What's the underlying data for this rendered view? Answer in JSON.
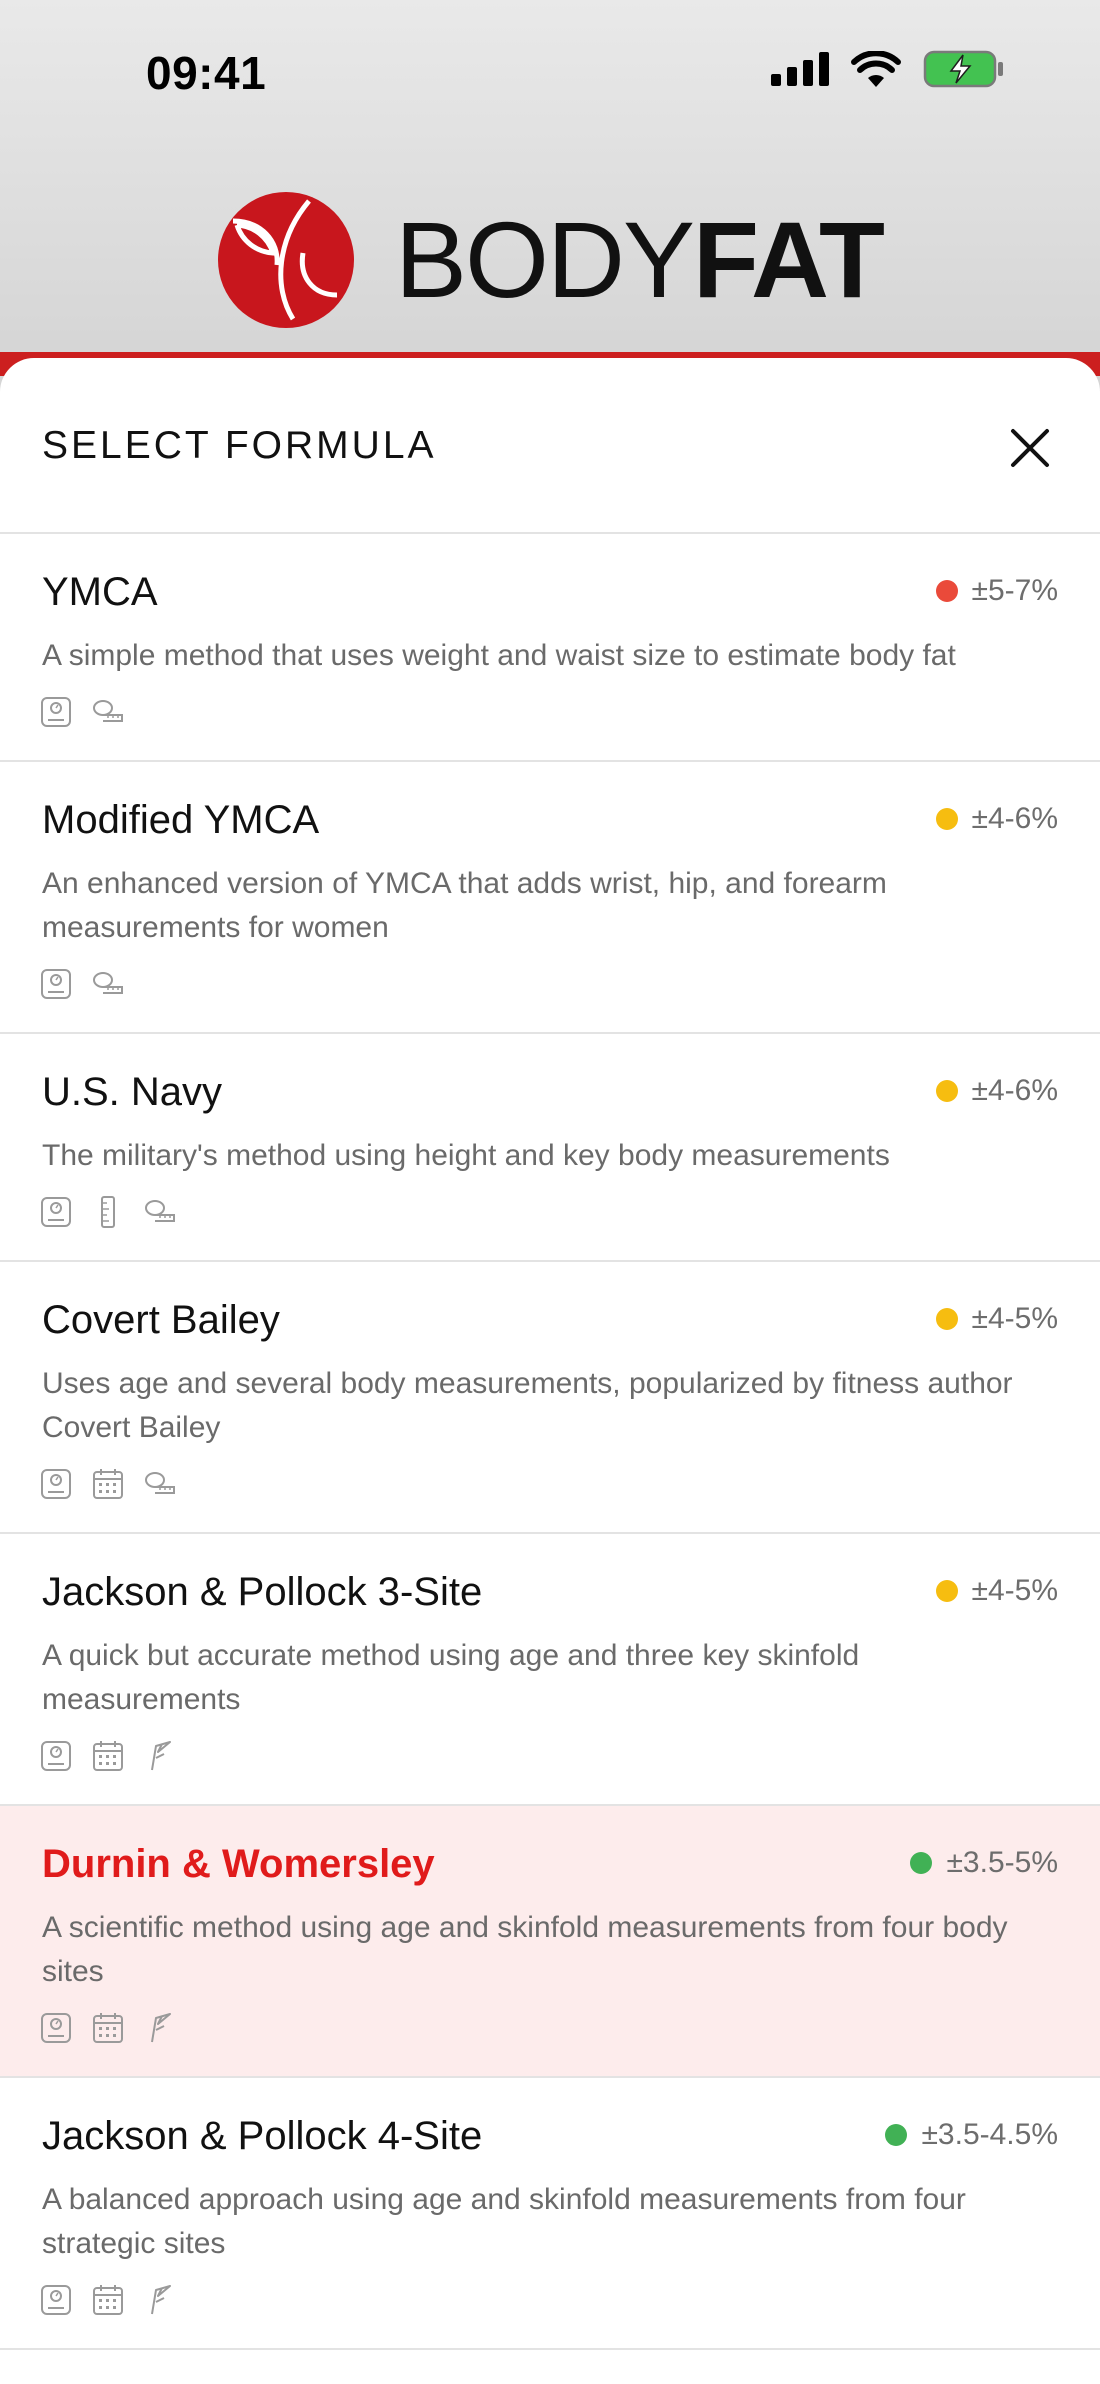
{
  "status": {
    "time": "09:41"
  },
  "logo": {
    "word_thin": "BODY",
    "word_bold": "FAT"
  },
  "sheet": {
    "title": "SELECT FORMULA"
  },
  "colors": {
    "red": "#e74c3c",
    "yellow": "#f5bd0c",
    "green": "#3fb14f",
    "brand_red": "#c8161d"
  },
  "formulas": [
    {
      "name": "YMCA",
      "accuracy": "±5-7%",
      "dot_color": "#ea4a3a",
      "description": "A simple method that uses weight and waist size to estimate body fat",
      "icons": [
        "scale-icon",
        "tape-measure-icon"
      ],
      "selected": false
    },
    {
      "name": "Modified YMCA",
      "accuracy": "±4-6%",
      "dot_color": "#f6bd10",
      "description": "An enhanced version of YMCA that adds wrist, hip, and forearm measurements for women",
      "icons": [
        "scale-icon",
        "tape-measure-icon"
      ],
      "selected": false
    },
    {
      "name": "U.S. Navy",
      "accuracy": "±4-6%",
      "dot_color": "#f6bd10",
      "description": "The military's method using height and key body measurements",
      "icons": [
        "scale-icon",
        "height-ruler-icon",
        "tape-measure-icon"
      ],
      "selected": false
    },
    {
      "name": "Covert Bailey",
      "accuracy": "±4-5%",
      "dot_color": "#f6bd10",
      "description": "Uses age and several body measurements, popularized by fitness author Covert Bailey",
      "icons": [
        "scale-icon",
        "calendar-icon",
        "tape-measure-icon"
      ],
      "selected": false
    },
    {
      "name": "Jackson & Pollock 3-Site",
      "accuracy": "±4-5%",
      "dot_color": "#f6bd10",
      "description": "A quick but accurate method using age and three key skinfold measurements",
      "icons": [
        "scale-icon",
        "calendar-icon",
        "caliper-icon"
      ],
      "selected": false
    },
    {
      "name": "Durnin & Womersley",
      "accuracy": "±3.5-5%",
      "dot_color": "#41b155",
      "description": "A scientific method using age and skinfold measurements from four body sites",
      "icons": [
        "scale-icon",
        "calendar-icon",
        "caliper-icon"
      ],
      "selected": true
    },
    {
      "name": "Jackson & Pollock 4-Site",
      "accuracy": "±3.5-4.5%",
      "dot_color": "#41b155",
      "description": "A balanced approach using age and skinfold measurements from four strategic sites",
      "icons": [
        "scale-icon",
        "calendar-icon",
        "caliper-icon"
      ],
      "selected": false
    }
  ]
}
